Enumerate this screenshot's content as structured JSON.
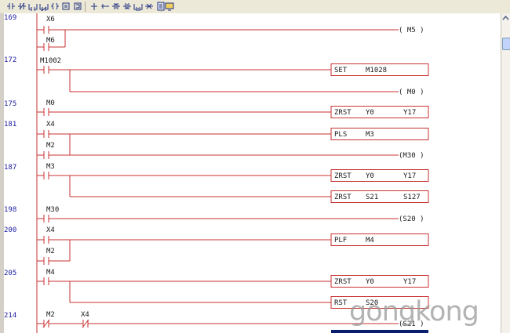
{
  "toolbar": {
    "buttons": [
      {
        "icon": "contact-no-icon"
      },
      {
        "icon": "contact-nc-icon"
      },
      {
        "icon": "parallel-no-icon"
      },
      {
        "icon": "parallel-nc-icon"
      },
      {
        "icon": "coil-icon"
      },
      {
        "icon": "function-key-f3-icon"
      },
      {
        "icon": "function-key-f9-icon"
      },
      {
        "icon": "vertical-line-icon"
      },
      {
        "icon": "horizontal-line-icon"
      },
      {
        "icon": "rising-pulse-icon"
      },
      {
        "icon": "falling-pulse-icon"
      },
      {
        "icon": "parallel-pulse-icon"
      },
      {
        "icon": "delete-line-icon"
      },
      {
        "icon": "comment-icon"
      },
      {
        "icon": "monitor-icon"
      }
    ]
  },
  "colors": {
    "rung": "#c83232",
    "step": "#1a1aa0",
    "label": "#1a1a1a",
    "toolbar_bg": "#ece9d8"
  },
  "rungs": [
    {
      "step": "169",
      "elements": [
        {
          "kind": "contact",
          "label": "X6"
        },
        {
          "kind": "contact",
          "label": "M6"
        },
        {
          "kind": "coil",
          "text": "( M5    )"
        }
      ]
    },
    {
      "step": "172",
      "elements": [
        {
          "kind": "contact",
          "label": "M1002"
        },
        {
          "kind": "box",
          "op": "SET",
          "arg1": "M1028",
          "arg2": ""
        },
        {
          "kind": "coil",
          "text": "( M0    )"
        }
      ]
    },
    {
      "step": "175",
      "elements": [
        {
          "kind": "contact",
          "label": "M0"
        },
        {
          "kind": "box",
          "op": "ZRST",
          "arg1": "Y0",
          "arg2": "Y17"
        }
      ]
    },
    {
      "step": "181",
      "elements": [
        {
          "kind": "contact",
          "label": "X4"
        },
        {
          "kind": "contact",
          "label": "M2"
        },
        {
          "kind": "box",
          "op": "PLS",
          "arg1": "M3",
          "arg2": ""
        },
        {
          "kind": "coil",
          "text": "(M30    )"
        }
      ]
    },
    {
      "step": "187",
      "elements": [
        {
          "kind": "contact",
          "label": "M3"
        },
        {
          "kind": "box",
          "op": "ZRST",
          "arg1": "Y0",
          "arg2": "Y17"
        },
        {
          "kind": "box",
          "op": "ZRST",
          "arg1": "S21",
          "arg2": "S127"
        }
      ]
    },
    {
      "step": "198",
      "elements": [
        {
          "kind": "contact",
          "label": "M30"
        },
        {
          "kind": "coil",
          "text": "(S20    )"
        }
      ]
    },
    {
      "step": "200",
      "elements": [
        {
          "kind": "contact",
          "label": "X4"
        },
        {
          "kind": "contact",
          "label": "M2"
        },
        {
          "kind": "box",
          "op": "PLF",
          "arg1": "M4",
          "arg2": ""
        }
      ]
    },
    {
      "step": "205",
      "elements": [
        {
          "kind": "contact",
          "label": "M4"
        },
        {
          "kind": "box",
          "op": "ZRST",
          "arg1": "Y0",
          "arg2": "Y17"
        },
        {
          "kind": "box",
          "op": "RST",
          "arg1": "S20",
          "arg2": ""
        }
      ]
    },
    {
      "step": "214",
      "elements": [
        {
          "kind": "contact-nc",
          "label": "M2"
        },
        {
          "kind": "contact-nc",
          "label": "X4"
        },
        {
          "kind": "coil",
          "text": "(S21    )"
        }
      ]
    }
  ],
  "watermark": "gongkong"
}
